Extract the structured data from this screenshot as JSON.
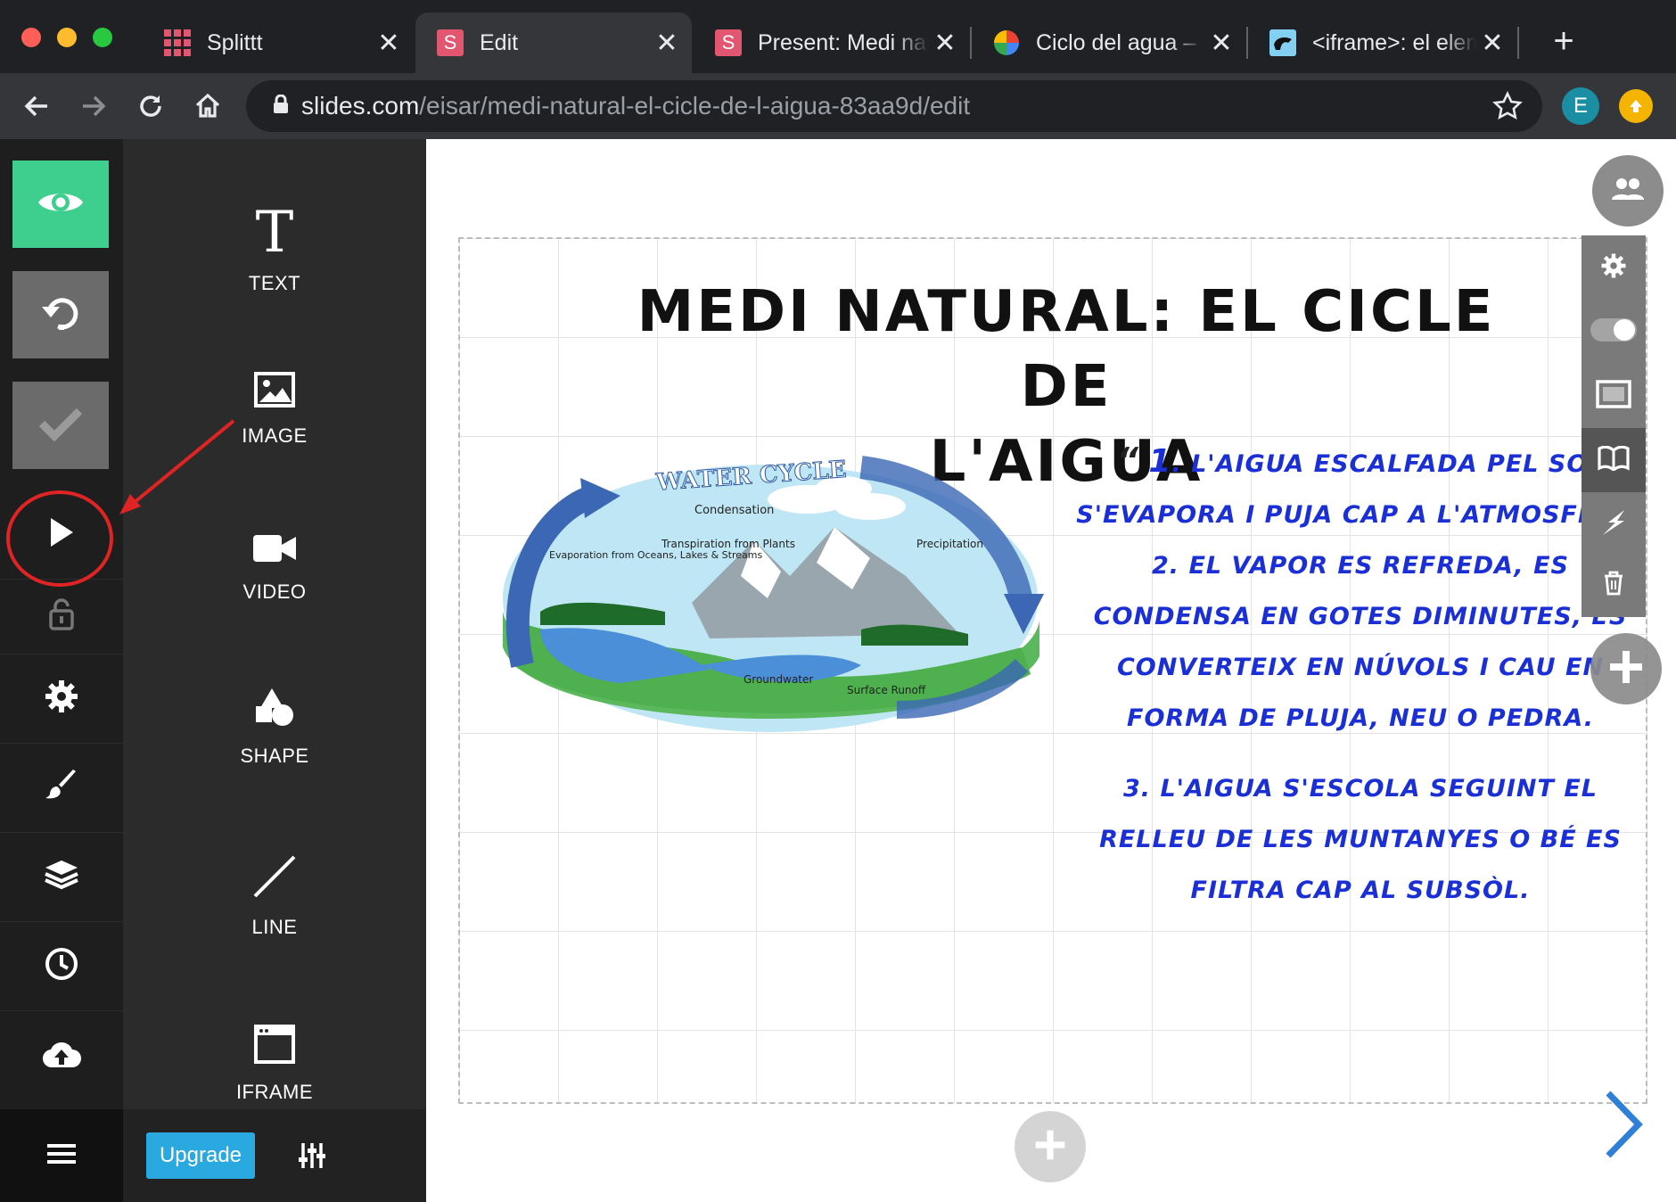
{
  "browser": {
    "tabs": [
      {
        "title": "Splittt",
        "favicon": "grid-favicon",
        "active": false
      },
      {
        "title": "Edit",
        "favicon": "slides-favicon",
        "active": true
      },
      {
        "title": "Present: Medi natural",
        "favicon": "slides-favicon",
        "active": false
      },
      {
        "title": "Ciclo del agua – ",
        "favicon": "pinwheel-favicon",
        "active": false
      },
      {
        "title": "<iframe>: el elemento",
        "favicon": "mdn-favicon",
        "active": false
      }
    ],
    "url_host": "slides.com",
    "url_path": "/eisar/medi-natural-el-cicle-de-l-aigua-83aa9d/edit",
    "profile_initial": "E",
    "colors": {
      "tabbar": "#202124",
      "toolbar": "#35363a",
      "profile": "#1a8fa4",
      "extension": "#f4b400"
    }
  },
  "rail": {
    "items": [
      "preview-icon",
      "undo-icon",
      "save-check-icon",
      "present-play-icon",
      "lock-icon",
      "settings-gear-icon",
      "style-brush-icon",
      "layers-icon",
      "history-clock-icon",
      "cloud-upload-icon",
      "menu-icon"
    ],
    "accent_color": "#3ecf8e"
  },
  "panel": {
    "items": [
      {
        "label": "TEXT",
        "icon": "text-icon"
      },
      {
        "label": "IMAGE",
        "icon": "image-icon"
      },
      {
        "label": "VIDEO",
        "icon": "video-camera-icon"
      },
      {
        "label": "SHAPE",
        "icon": "shape-icon"
      },
      {
        "label": "LINE",
        "icon": "line-icon"
      },
      {
        "label": "IFRAME",
        "icon": "iframe-icon"
      }
    ],
    "upgrade_label": "Upgrade",
    "upgrade_color": "#2aa8e0"
  },
  "slide": {
    "title_line1": "MEDI NATURAL: EL CICLE DE",
    "title_line2": "L'AIGUA",
    "quote_mark": "“",
    "point1_num": "1",
    "point1_text": ". L'AIGUA ESCALFADA PEL SOL S'EVAPORA I PUJA CAP A L'ATMOSFERA.",
    "point2_text": "2. EL VAPOR ES REFREDA, ES CONDENSA EN GOTES DIMINUTES, ES CONVERTEIX EN NÚVOLS I CAU EN FORMA DE PLUJA, NEU O PEDRA.",
    "point3_text": "3. L'AIGUA S'ESCOLA SEGUINT EL RELLEU DE LES MUNTANYES O BÉ ES FILTRA CAP AL SUBSÒL.",
    "text_color": "#1a2fd6",
    "image": {
      "title": "WATER CYCLE",
      "labels": {
        "condensation": "Condensation",
        "transpiration": "Transpiration from Plants",
        "evaporation": "Evaporation from Oceans, Lakes & Streams",
        "precipitation": "Precipitation",
        "groundwater": "Groundwater",
        "runoff": "Surface Runoff"
      }
    }
  },
  "slide_toolbar": [
    "settings-gear-icon",
    "toggle-icon",
    "frame-icon",
    "book-icon",
    "lightning-icon",
    "trash-icon"
  ],
  "annotation": {
    "color": "#e02424",
    "target": "present-play-icon"
  }
}
